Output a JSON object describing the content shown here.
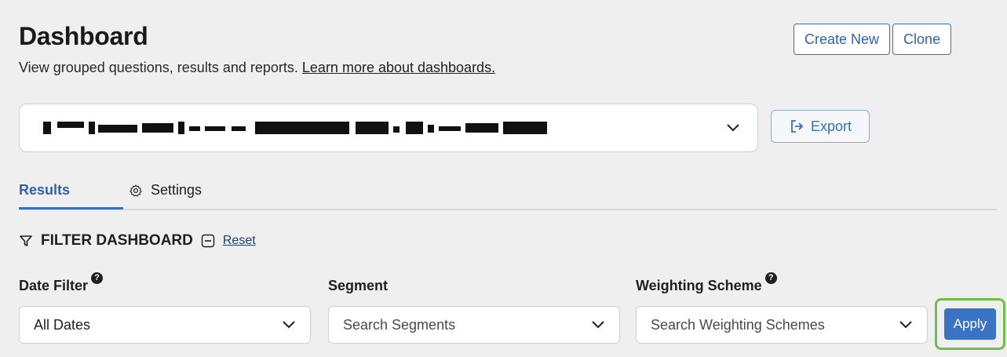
{
  "header": {
    "title": "Dashboard",
    "subtitle": "View grouped questions, results and reports.",
    "learn_more_link": "Learn more about dashboards.",
    "create_new_label": "Create New",
    "clone_label": "Clone"
  },
  "dashboard_select": {
    "selected_value_redacted": true
  },
  "export": {
    "label": "Export"
  },
  "tabs": [
    {
      "label": "Results",
      "active": true
    },
    {
      "label": "Settings",
      "active": false,
      "icon": "gear-icon"
    }
  ],
  "filter": {
    "heading": "FILTER DASHBOARD",
    "reset_label": "Reset",
    "fields": [
      {
        "label": "Date Filter",
        "has_help": true,
        "value": "All Dates"
      },
      {
        "label": "Segment",
        "has_help": false,
        "placeholder": "Search Segments"
      },
      {
        "label": "Weighting Scheme",
        "has_help": true,
        "placeholder": "Search Weighting Schemes"
      }
    ],
    "apply_label": "Apply"
  },
  "colors": {
    "accent": "#3b6fb8",
    "apply_bg": "#3a72c4",
    "highlight": "#6cc04a",
    "background": "#efefef"
  }
}
